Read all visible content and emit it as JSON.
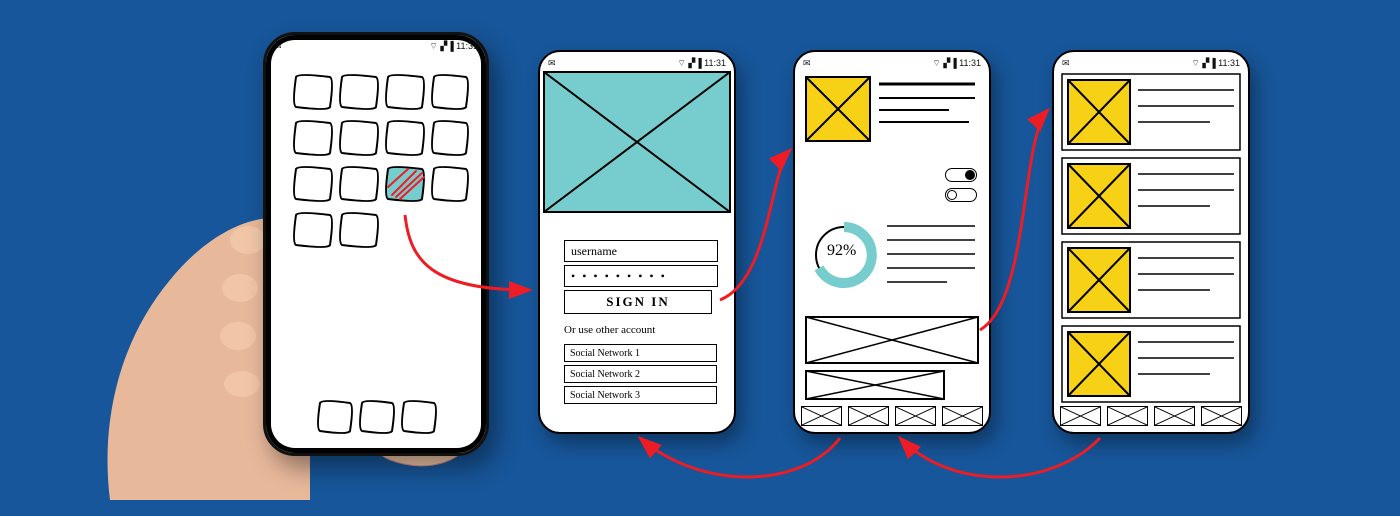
{
  "background_color": "#17569a",
  "accent_teal": "#77cccd",
  "accent_yellow": "#f7d116",
  "arrow_color": "#ee1c24",
  "statusbar": {
    "time": "11:31",
    "icons": [
      "mail",
      "wifi",
      "signal",
      "battery"
    ]
  },
  "screens": {
    "home": {
      "name": "home-screen",
      "grid_rows": 4,
      "grid_cols": 4,
      "highlighted_index": 6,
      "dock_icon_count": 3
    },
    "login": {
      "name": "sign-in-screen",
      "username_placeholder": "username",
      "password_mask": "• • • • • • • • •",
      "sign_in_label": "SIGN IN",
      "alt_label": "Or use other account",
      "social_buttons": [
        "Social Network 1",
        "Social Network 2",
        "Social Network 3"
      ]
    },
    "dashboard": {
      "name": "dashboard-screen",
      "toggles": [
        true,
        false
      ],
      "progress_percent": "92%",
      "text_line_count_top": 4,
      "text_line_count_mid": 5,
      "tab_count": 4
    },
    "list": {
      "name": "list-screen",
      "item_count": 4,
      "lines_per_item": 3,
      "tab_count": 4
    }
  },
  "flow_arrows": [
    {
      "from": "home.highlighted_icon",
      "to": "login"
    },
    {
      "from": "login.sign_in",
      "to": "dashboard"
    },
    {
      "from": "dashboard.banner",
      "to": "list"
    },
    {
      "from": "dashboard.tabbar",
      "to": "login.bottom"
    },
    {
      "from": "list.tabbar",
      "to": "dashboard.bottom"
    }
  ]
}
